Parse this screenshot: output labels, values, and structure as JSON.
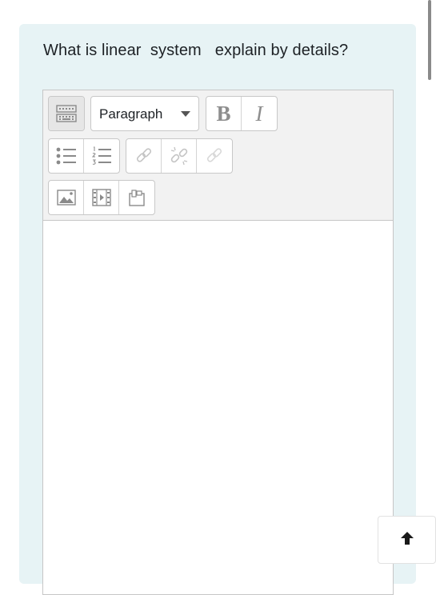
{
  "question": {
    "text": "What is linear  system   explain by details?"
  },
  "editor": {
    "paragraph_select": {
      "selected": "Paragraph"
    },
    "toolbar": {
      "row1": [
        "toolbar-toggle-icon",
        "paragraph-style-select",
        "bold-icon",
        "italic-icon"
      ],
      "row2": [
        "unordered-list-icon",
        "ordered-list-icon",
        "link-icon",
        "unlink-icon",
        "link-disabled-icon"
      ],
      "row3": [
        "image-icon",
        "media-icon",
        "manage-files-icon"
      ]
    },
    "bold_glyph": "B",
    "italic_glyph": "I",
    "content": ""
  },
  "back_to_top": {
    "icon": "arrow-up-icon"
  },
  "colors": {
    "card_background": "#e7f3f5",
    "toolbar_background": "#f2f2f2",
    "text": "#1d2125",
    "disabled_icon": "#c4c4c4"
  }
}
